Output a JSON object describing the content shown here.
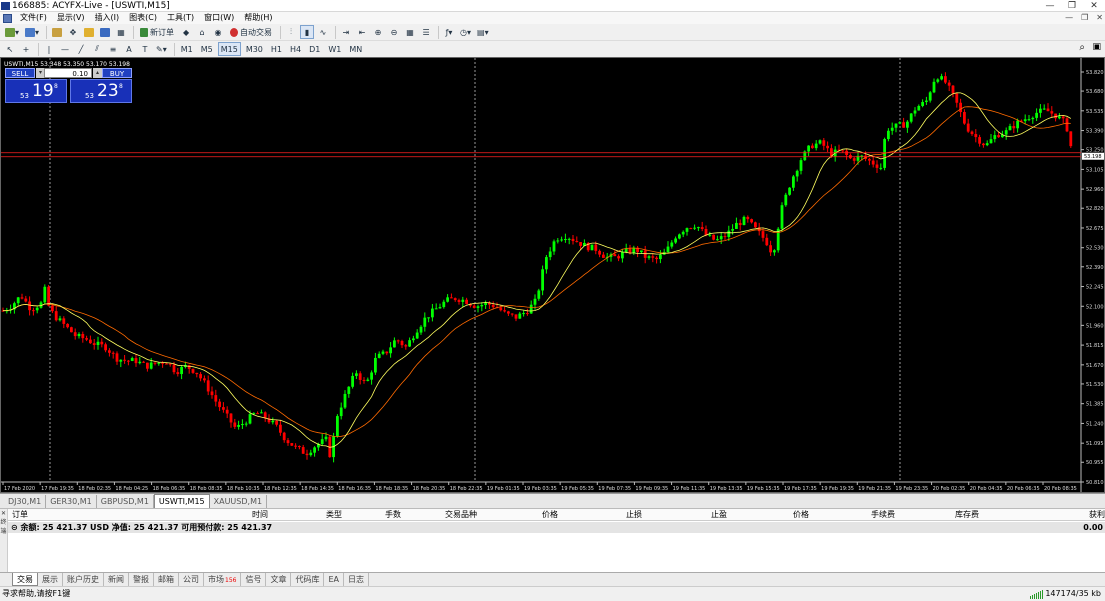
{
  "window": {
    "title": "166885: ACYFX-Live - [USWTI,M15]",
    "min": "—",
    "max": "❐",
    "close": "✕"
  },
  "menu": [
    "文件(F)",
    "显示(V)",
    "插入(I)",
    "图表(C)",
    "工具(T)",
    "窗口(W)",
    "帮助(H)"
  ],
  "toolbar": {
    "new_order": "新订单",
    "auto_trading": "自动交易"
  },
  "timeframes": [
    "M1",
    "M5",
    "M15",
    "M30",
    "H1",
    "H4",
    "D1",
    "W1",
    "MN"
  ],
  "active_timeframe": "M15",
  "chart": {
    "header": "USWTI,M15  53.348 53.350 53.170 53.198",
    "current_price": "53.198",
    "price_line_color": "#ff2020",
    "bull_color": "#00ff00",
    "bear_color": "#ff0000",
    "ma_fast_color": "#ffff60",
    "ma_slow_color": "#ff6a00"
  },
  "one_click": {
    "sell_label": "SELL",
    "buy_label": "BUY",
    "lot": "0.10",
    "sell_prefix": "53",
    "sell_big": "19",
    "sell_sup": "8",
    "buy_prefix": "53",
    "buy_big": "23",
    "buy_sup": "8"
  },
  "chart_data": {
    "type": "candlestick",
    "symbol": "USWTI",
    "timeframe": "M15",
    "y_ticks": [
      "53.820",
      "53.680",
      "53.535",
      "53.390",
      "53.250",
      "53.105",
      "52.960",
      "52.820",
      "52.675",
      "52.530",
      "52.390",
      "52.245",
      "52.100",
      "51.960",
      "51.815",
      "51.670",
      "51.530",
      "51.385",
      "51.240",
      "51.095",
      "50.955",
      "50.810"
    ],
    "ylim": [
      50.81,
      53.82
    ],
    "x_ticks": [
      "17 Feb 2020",
      "17 Feb 19:35",
      "18 Feb 02:35",
      "18 Feb 04:25",
      "18 Feb 06:35",
      "18 Feb 08:35",
      "18 Feb 10:35",
      "18 Feb 12:35",
      "18 Feb 14:35",
      "18 Feb 16:35",
      "18 Feb 18:35",
      "18 Feb 20:35",
      "18 Feb 22:35",
      "19 Feb 01:35",
      "19 Feb 03:35",
      "19 Feb 05:35",
      "19 Feb 07:35",
      "19 Feb 09:35",
      "19 Feb 11:35",
      "19 Feb 13:35",
      "19 Feb 15:35",
      "19 Feb 17:35",
      "19 Feb 19:35",
      "19 Feb 21:35",
      "19 Feb 23:35",
      "20 Feb 02:35",
      "20 Feb 04:35",
      "20 Feb 06:35",
      "20 Feb 08:35"
    ],
    "close_path": [
      [
        0,
        52.06
      ],
      [
        10,
        52.1
      ],
      [
        20,
        52.18
      ],
      [
        30,
        52.08
      ],
      [
        40,
        52.12
      ],
      [
        45,
        52.25
      ],
      [
        48,
        52.08
      ],
      [
        55,
        52.02
      ],
      [
        65,
        51.95
      ],
      [
        75,
        51.88
      ],
      [
        85,
        51.86
      ],
      [
        95,
        51.82
      ],
      [
        105,
        51.8
      ],
      [
        115,
        51.72
      ],
      [
        125,
        51.7
      ],
      [
        135,
        51.7
      ],
      [
        145,
        51.66
      ],
      [
        155,
        51.68
      ],
      [
        165,
        51.7
      ],
      [
        175,
        51.62
      ],
      [
        185,
        51.66
      ],
      [
        195,
        51.62
      ],
      [
        205,
        51.52
      ],
      [
        215,
        51.4
      ],
      [
        225,
        51.3
      ],
      [
        235,
        51.2
      ],
      [
        245,
        51.26
      ],
      [
        255,
        51.32
      ],
      [
        265,
        51.28
      ],
      [
        275,
        51.22
      ],
      [
        285,
        51.12
      ],
      [
        295,
        51.06
      ],
      [
        305,
        51.02
      ],
      [
        315,
        51.08
      ],
      [
        325,
        51.12
      ],
      [
        330,
        50.98
      ],
      [
        335,
        51.28
      ],
      [
        345,
        51.46
      ],
      [
        355,
        51.62
      ],
      [
        365,
        51.52
      ],
      [
        375,
        51.72
      ],
      [
        385,
        51.76
      ],
      [
        395,
        51.86
      ],
      [
        405,
        51.8
      ],
      [
        415,
        51.92
      ],
      [
        425,
        52.02
      ],
      [
        435,
        52.08
      ],
      [
        445,
        52.14
      ],
      [
        455,
        52.16
      ],
      [
        465,
        52.14
      ],
      [
        475,
        52.1
      ],
      [
        485,
        52.12
      ],
      [
        495,
        52.1
      ],
      [
        505,
        52.04
      ],
      [
        515,
        52.02
      ],
      [
        525,
        52.06
      ],
      [
        535,
        52.14
      ],
      [
        545,
        52.46
      ],
      [
        555,
        52.6
      ],
      [
        565,
        52.62
      ],
      [
        575,
        52.58
      ],
      [
        585,
        52.54
      ],
      [
        595,
        52.52
      ],
      [
        605,
        52.46
      ],
      [
        615,
        52.46
      ],
      [
        625,
        52.5
      ],
      [
        635,
        52.52
      ],
      [
        645,
        52.46
      ],
      [
        655,
        52.44
      ],
      [
        665,
        52.5
      ],
      [
        675,
        52.62
      ],
      [
        685,
        52.68
      ],
      [
        695,
        52.7
      ],
      [
        705,
        52.62
      ],
      [
        715,
        52.58
      ],
      [
        725,
        52.62
      ],
      [
        735,
        52.7
      ],
      [
        745,
        52.74
      ],
      [
        755,
        52.66
      ],
      [
        765,
        52.58
      ],
      [
        772,
        52.48
      ],
      [
        780,
        52.8
      ],
      [
        790,
        53.02
      ],
      [
        800,
        53.18
      ],
      [
        810,
        53.28
      ],
      [
        820,
        53.3
      ],
      [
        830,
        53.22
      ],
      [
        840,
        53.24
      ],
      [
        850,
        53.18
      ],
      [
        860,
        53.2
      ],
      [
        870,
        53.16
      ],
      [
        880,
        53.12
      ],
      [
        885,
        53.4
      ],
      [
        895,
        53.42
      ],
      [
        905,
        53.44
      ],
      [
        915,
        53.56
      ],
      [
        925,
        53.6
      ],
      [
        935,
        53.8
      ],
      [
        945,
        53.74
      ],
      [
        955,
        53.6
      ],
      [
        965,
        53.42
      ],
      [
        975,
        53.34
      ],
      [
        985,
        53.28
      ],
      [
        995,
        53.36
      ],
      [
        1005,
        53.38
      ],
      [
        1015,
        53.44
      ],
      [
        1025,
        53.48
      ],
      [
        1035,
        53.52
      ],
      [
        1045,
        53.54
      ],
      [
        1055,
        53.5
      ],
      [
        1065,
        53.44
      ],
      [
        1072,
        53.2
      ]
    ]
  },
  "sheet_tabs": [
    "DJ30,M1",
    "GER30,M1",
    "GBPUSD,M1",
    "USWTI,M15",
    "XAUUSD,M1"
  ],
  "active_sheet": "USWTI,M15",
  "terminal": {
    "side_label": "终端",
    "headers": [
      "订单",
      "时间",
      "类型",
      "手数",
      "交易品种",
      "价格",
      "止损",
      "止盈",
      "价格",
      "手续费",
      "库存费",
      "获利"
    ],
    "balance_line": "余额: 25 421.37 USD  净值: 25 421.37  可用预付款: 25 421.37",
    "balance_profit": "0.00"
  },
  "bottom_tabs": [
    {
      "label": "交易",
      "badge": ""
    },
    {
      "label": "展示",
      "badge": ""
    },
    {
      "label": "账户历史",
      "badge": ""
    },
    {
      "label": "新闻",
      "badge": ""
    },
    {
      "label": "警报",
      "badge": ""
    },
    {
      "label": "邮箱",
      "badge": ""
    },
    {
      "label": "公司",
      "badge": ""
    },
    {
      "label": "市场",
      "badge": "156"
    },
    {
      "label": "信号",
      "badge": ""
    },
    {
      "label": "文章",
      "badge": ""
    },
    {
      "label": "代码库",
      "badge": ""
    },
    {
      "label": "EA",
      "badge": ""
    },
    {
      "label": "日志",
      "badge": ""
    }
  ],
  "active_bottom_tab": "交易",
  "status": {
    "help": "寻求帮助,请按F1键",
    "traffic": "147174/35 kb"
  }
}
